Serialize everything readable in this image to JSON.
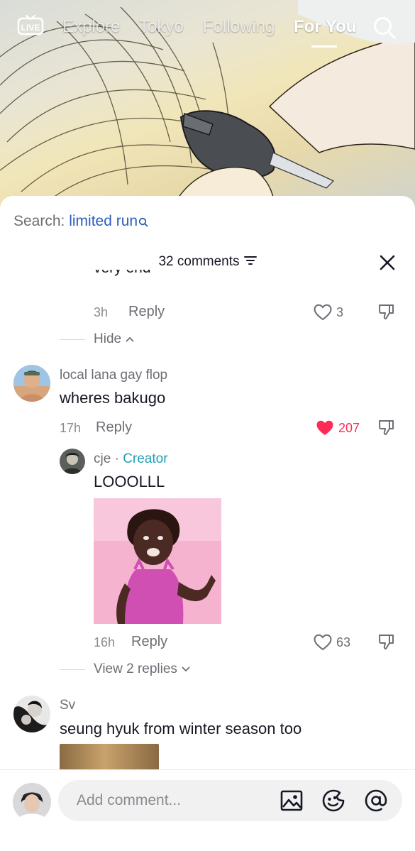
{
  "nav": {
    "live_label": "LIVE",
    "tabs": [
      "Explore",
      "Tokyo",
      "Following",
      "For You"
    ],
    "active_tab": "For You"
  },
  "search": {
    "prefix": "Search:",
    "term": "limited run"
  },
  "comments": {
    "count_label": "32 comments",
    "truncated_text": "very end",
    "truncated_meta": {
      "time": "3h",
      "reply": "Reply",
      "likes": "3"
    },
    "hide_label": "Hide",
    "items": [
      {
        "username": "local lana gay flop",
        "text": "wheres bakugo",
        "time": "17h",
        "reply": "Reply",
        "likes": "207",
        "liked": true
      }
    ],
    "creator_reply": {
      "username": "cje",
      "separator": "·",
      "badge": "Creator",
      "text": "LOOOLLL",
      "time": "16h",
      "reply": "Reply",
      "likes": "63",
      "view_replies_label": "View 2 replies"
    },
    "last_comment": {
      "username": "Sv",
      "text": "seung hyuk from winter season too"
    }
  },
  "input": {
    "placeholder": "Add comment..."
  },
  "colors": {
    "accent": "#fe2c55",
    "search_link": "#2b5db9",
    "creator": "#20a0b4"
  },
  "icons": [
    "live-icon",
    "search-icon",
    "filter-icon",
    "close-icon",
    "heart-icon",
    "dislike-icon",
    "chevron-up-icon",
    "chevron-down-icon",
    "image-icon",
    "emoji-icon",
    "mention-icon"
  ]
}
